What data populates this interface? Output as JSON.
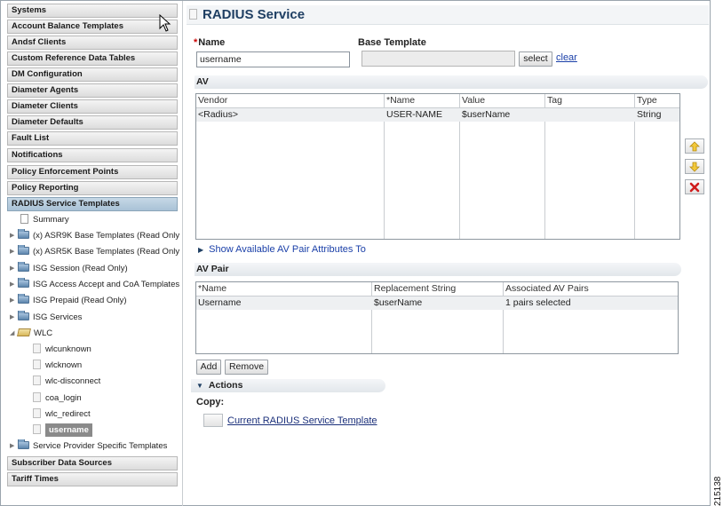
{
  "sidebar": {
    "top_headers": [
      "Systems",
      "Account Balance Templates",
      "Andsf Clients",
      "Custom Reference Data Tables",
      "DM Configuration",
      "Diameter Agents",
      "Diameter Clients",
      "Diameter Defaults",
      "Fault List",
      "Notifications",
      "Policy Enforcement Points",
      "Policy Reporting"
    ],
    "active_header": "RADIUS Service Templates",
    "tree": {
      "summary": "Summary",
      "folders": [
        "(x) ASR9K Base Templates (Read Only",
        "(x) ASR5K Base Templates (Read Only",
        "ISG Session (Read Only)",
        "ISG Access Accept and CoA Templates",
        "ISG Prepaid (Read Only)",
        "ISG Services"
      ],
      "open_folder": "WLC",
      "wlc_children": [
        "wlcunknown",
        "wlcknown",
        "wlc-disconnect",
        "coa_login",
        "wlc_redirect"
      ],
      "selected_child": "username",
      "last_folder": "Service Provider Specific Templates"
    },
    "bottom_headers": [
      "Subscriber Data Sources",
      "Tariff Times"
    ]
  },
  "main": {
    "title": "RADIUS Service",
    "name_label": "Name",
    "name_value": "username",
    "base_template_label": "Base Template",
    "base_template_value": "",
    "select_button": "select",
    "clear_link": "clear",
    "av": {
      "section": "AV",
      "columns": [
        "Vendor",
        "*Name",
        "Value",
        "Tag",
        "Type"
      ],
      "rows": [
        [
          "<Radius>",
          "USER-NAME",
          "$userName",
          "",
          "String"
        ]
      ]
    },
    "show_available": "Show Available AV Pair Attributes To",
    "av_pair": {
      "section": "AV Pair",
      "columns": [
        "*Name",
        "Replacement String",
        "Associated AV Pairs"
      ],
      "rows": [
        [
          "Username",
          "$userName",
          "1 pairs selected"
        ]
      ]
    },
    "add_button": "Add",
    "remove_button": "Remove",
    "actions_section": "Actions",
    "copy_label": "Copy:",
    "copy_link": "Current RADIUS Service Template"
  },
  "figure_id": "215138",
  "colors": {
    "title": "#1f3f63",
    "link": "#1a3fa8",
    "active_header": "#a9c2d6"
  },
  "icons": [
    "cursor-arrow-icon",
    "folder-icon",
    "open-folder-icon",
    "page-icon",
    "move-up-icon",
    "move-down-icon",
    "delete-icon"
  ]
}
